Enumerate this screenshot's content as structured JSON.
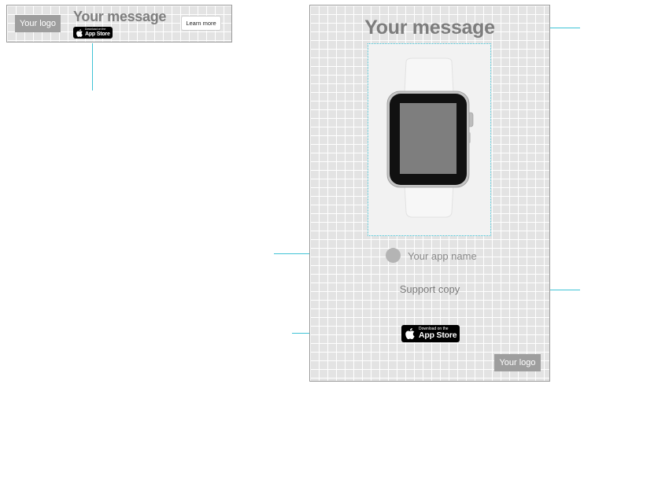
{
  "banner": {
    "logo_label": "Your logo",
    "message": "Your message",
    "badge_small": "Download on the",
    "badge_big": "App Store",
    "learn_more_label": "Learn more"
  },
  "ad": {
    "message": "Your message",
    "app_name": "Your app name",
    "support_copy": "Support copy",
    "badge_small": "Download on the",
    "badge_big": "App Store",
    "logo_label": "Your logo"
  },
  "colors": {
    "callout_line": "#3fc3d6",
    "placeholder_gray": "#9e9e9e",
    "grid_background": "#e3e3e3"
  },
  "icons": [
    "apple-icon",
    "watch-image"
  ]
}
